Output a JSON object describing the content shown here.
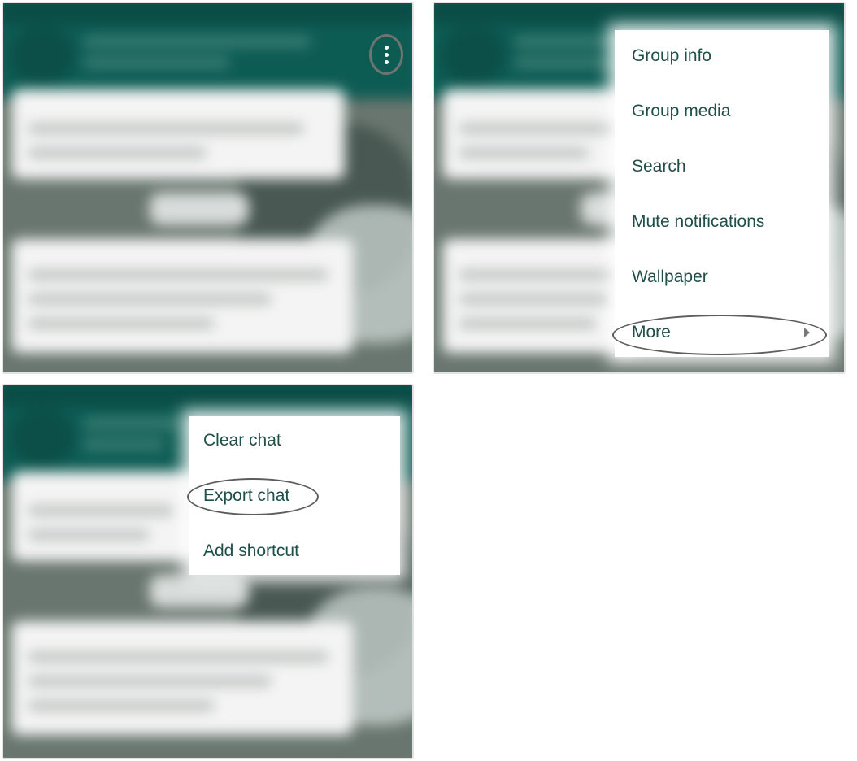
{
  "panel_1": {
    "overflow_icon": "vertical-dots-icon"
  },
  "panel_2": {
    "menu_items": [
      {
        "label": "Group info"
      },
      {
        "label": "Group media"
      },
      {
        "label": "Search"
      },
      {
        "label": "Mute notifications"
      },
      {
        "label": "Wallpaper"
      },
      {
        "label": "More",
        "submenu_icon": "triangle-right-icon"
      }
    ],
    "highlighted_item": "More"
  },
  "panel_3": {
    "menu_items": [
      {
        "label": "Clear chat"
      },
      {
        "label": "Export chat"
      },
      {
        "label": "Add shortcut"
      }
    ],
    "highlighted_item": "Export chat"
  },
  "colors": {
    "toolbar": "#0d5c54",
    "menu_text": "#1f4f49",
    "highlight_outline": "#5b5e5d"
  }
}
